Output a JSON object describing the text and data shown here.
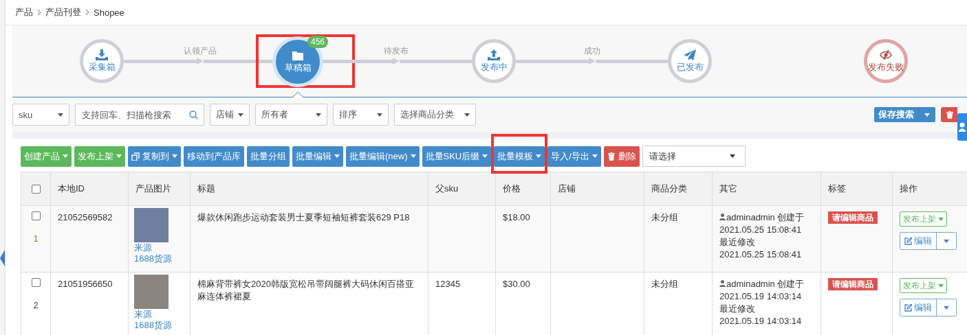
{
  "breadcrumb": [
    "产品",
    "产品刊登",
    "Shopee"
  ],
  "steps": [
    {
      "kind": "collect",
      "label": "采集箱",
      "selected": false,
      "next_label": "认领产品"
    },
    {
      "kind": "draft",
      "label": "草稿箱",
      "selected": true,
      "badge": "456",
      "highlighted": true,
      "next_label": "待发布"
    },
    {
      "kind": "publishing",
      "label": "发布中",
      "selected": false,
      "next_label": "成功"
    },
    {
      "kind": "published",
      "label": "已发布",
      "selected": false
    },
    {
      "kind": "failed",
      "label": "发布失败",
      "selected": false
    }
  ],
  "filters": [
    {
      "kind": "select",
      "value": "sku"
    },
    {
      "kind": "search",
      "placeholder": "支持回车、扫描枪搜索"
    },
    {
      "kind": "dropdown",
      "label": "店铺"
    },
    {
      "kind": "select",
      "value": "所有者"
    },
    {
      "kind": "select",
      "value": "排序"
    },
    {
      "kind": "select",
      "value": "选择商品分类"
    }
  ],
  "search_actions": [
    {
      "kind": "split",
      "label": "保存搜索"
    },
    {
      "kind": "delete"
    }
  ],
  "toolbar": [
    {
      "label": "创建产品",
      "kind": "create",
      "caret": true
    },
    {
      "label": "发布上架",
      "kind": "create",
      "caret": true
    },
    {
      "label": "复制到",
      "kind": "copy",
      "caret": true
    },
    {
      "label": "移动到产品库",
      "kind": "batch",
      "caret": false
    },
    {
      "label": "批量分组",
      "kind": "batch",
      "caret": false
    },
    {
      "label": "批量编辑",
      "kind": "batch",
      "caret": true
    },
    {
      "label": "批量编辑(new)",
      "kind": "batch",
      "caret": true
    },
    {
      "label": "批量SKU后缀",
      "kind": "batch",
      "caret": true
    },
    {
      "label": "批量模板",
      "kind": "batch",
      "caret": true,
      "highlighted": true
    },
    {
      "label": "导入/导出",
      "kind": "batch",
      "caret": true
    },
    {
      "label": "删除",
      "kind": "delete",
      "caret": false
    }
  ],
  "toolbar_select": {
    "value": "请选择"
  },
  "table": {
    "select_all_checked": false,
    "columns": [
      "本地ID",
      "产品图片",
      "标题",
      "父sku",
      "价格",
      "店铺",
      "商品分类",
      "其它",
      "标签",
      "操作"
    ],
    "rows": [
      {
        "checked": false,
        "index": "1",
        "id": "21052569582",
        "image_links": [
          "来源",
          "1688货源"
        ],
        "title": "爆款休闲跑步运动套装男士夏季短袖短裤套装629 P18",
        "parent_sku": "",
        "price": "$18.00",
        "shop": "",
        "category": "未分组",
        "owner": "adminadmin",
        "created_label": "创建于",
        "created": "2021.05.25 15:08:41",
        "modified_label": "最近修改",
        "modified": "2021.05.25 15:08:41",
        "tag": "请编辑商品",
        "publish": "发布上架",
        "edit": "编辑"
      },
      {
        "checked": false,
        "index": "2",
        "id": "21051956650",
        "image_links": [
          "来源",
          "1688货源"
        ],
        "title": "棉麻背带裤女2020韩版宽松吊带阔腿裤大码休闲百搭亚麻连体裤裙夏",
        "parent_sku": "12345",
        "price": "$30.00",
        "shop": "",
        "category": "未分组",
        "owner": "adminadmin",
        "created_label": "创建于",
        "created": "2021.05.19 14:03:14",
        "modified_label": "最近修改",
        "modified": "2021.05.19 14:03:14",
        "tag": "请编辑商品",
        "publish": "发布上架",
        "edit": "编辑"
      }
    ]
  }
}
